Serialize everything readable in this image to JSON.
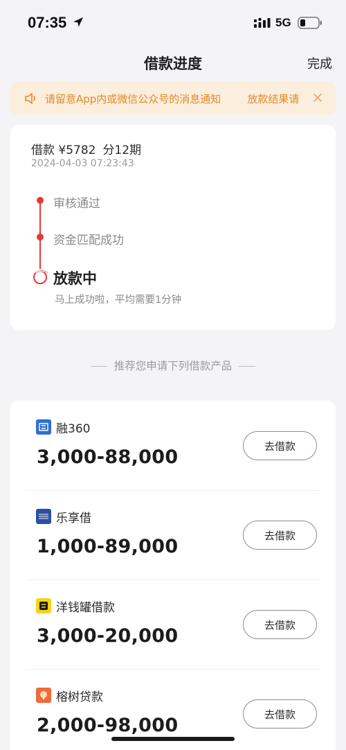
{
  "status_bar": {
    "time": "07:35",
    "network": "5G"
  },
  "nav": {
    "title": "借款进度",
    "done_label": "完成"
  },
  "notice": {
    "message": "请留意App内或微信公众号的消息通知",
    "message_tail": "放款结果请",
    "color": "#e08a2b",
    "background": "#fbeedd"
  },
  "loan": {
    "summary": "借款 ¥5782",
    "term": "分12期",
    "time": "2024-04-03 07:23:43",
    "steps": [
      {
        "label": "审核通过",
        "status": "done"
      },
      {
        "label": "资金匹配成功",
        "status": "done"
      },
      {
        "label": "放款中",
        "status": "current"
      }
    ],
    "current_sub": "马上成功啦，平均需要1分钟",
    "accent_color": "#e53935"
  },
  "recommend": {
    "heading": "推荐您申请下列借款产品"
  },
  "products": [
    {
      "name": "融360",
      "range": "3,000-88,000",
      "button": "去借款",
      "logo_icon": "rong360-logo-icon",
      "logo_color": "#2e6fd6"
    },
    {
      "name": "乐享借",
      "range": "1,000-89,000",
      "button": "去借款",
      "logo_icon": "lexiangjie-logo-icon",
      "logo_color": "#2d4fa3"
    },
    {
      "name": "洋钱罐借款",
      "range": "3,000-20,000",
      "button": "去借款",
      "logo_icon": "yangqianguan-logo-icon",
      "logo_color": "#f5d417"
    },
    {
      "name": "榕树贷款",
      "range": "2,000-98,000",
      "button": "去借款",
      "logo_icon": "rongshu-logo-icon",
      "logo_color": "#f06a3a"
    }
  ]
}
